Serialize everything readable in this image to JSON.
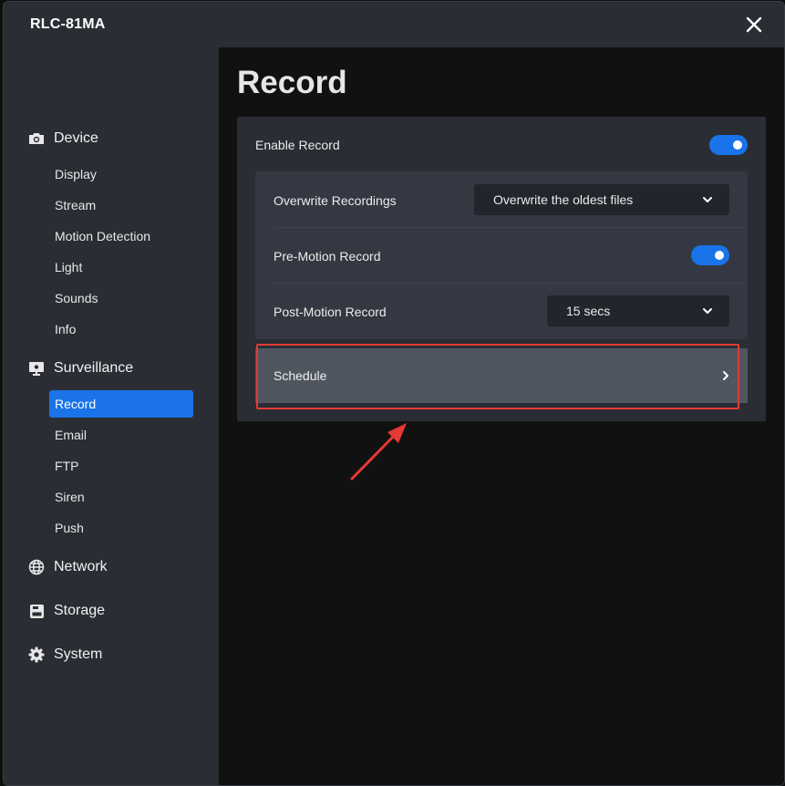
{
  "window": {
    "title": "RLC-81MA"
  },
  "sidebar": {
    "sections": [
      {
        "label": "Device",
        "icon": "camera-icon",
        "items": [
          {
            "label": "Display"
          },
          {
            "label": "Stream"
          },
          {
            "label": "Motion Detection"
          },
          {
            "label": "Light"
          },
          {
            "label": "Sounds"
          },
          {
            "label": "Info"
          }
        ]
      },
      {
        "label": "Surveillance",
        "icon": "monitor-icon",
        "items": [
          {
            "label": "Record",
            "active": true
          },
          {
            "label": "Email"
          },
          {
            "label": "FTP"
          },
          {
            "label": "Siren"
          },
          {
            "label": "Push"
          }
        ]
      },
      {
        "label": "Network",
        "icon": "globe-icon",
        "items": []
      },
      {
        "label": "Storage",
        "icon": "storage-icon",
        "items": []
      },
      {
        "label": "System",
        "icon": "gear-icon",
        "items": []
      }
    ]
  },
  "main": {
    "title": "Record",
    "enable_record": {
      "label": "Enable Record",
      "enabled": true
    },
    "overwrite": {
      "label": "Overwrite Recordings",
      "value": "Overwrite the oldest files"
    },
    "pre_motion": {
      "label": "Pre-Motion Record",
      "enabled": true
    },
    "post_motion": {
      "label": "Post-Motion Record",
      "value": "15 secs"
    },
    "schedule": {
      "label": "Schedule"
    }
  },
  "colors": {
    "accent": "#1a73e8",
    "annotation": "#e53935",
    "sidebar_bg": "#2a2d34"
  }
}
